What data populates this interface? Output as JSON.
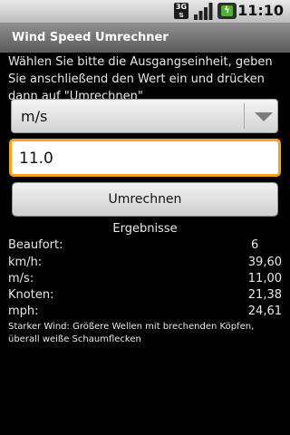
{
  "statusbar": {
    "network": "3G",
    "time": "11:10"
  },
  "app": {
    "title": "Wind Speed Umrechner"
  },
  "form": {
    "instructions": "Wählen Sie bitte die Ausgangseinheit, geben Sie anschließend den Wert ein und drücken dann auf \"Umrechnen\"",
    "unit_selected": "m/s",
    "value": "11.0",
    "convert_label": "Umrechnen"
  },
  "results": {
    "title": "Ergebnisse",
    "rows": [
      {
        "label": "Beaufort:",
        "value": "6"
      },
      {
        "label": "km/h:",
        "value": "39,60"
      },
      {
        "label": "m/s:",
        "value": "11,00"
      },
      {
        "label": "Knoten:",
        "value": "21,38"
      },
      {
        "label": "mph:",
        "value": "24,61"
      }
    ],
    "description": "Starker Wind: Größere Wellen mit brechenden Köpfen, überall weiße Schaumflecken"
  },
  "colors": {
    "background": "#000000",
    "focus_accent": "#f7a21b",
    "battery_green": "#52b12e"
  }
}
